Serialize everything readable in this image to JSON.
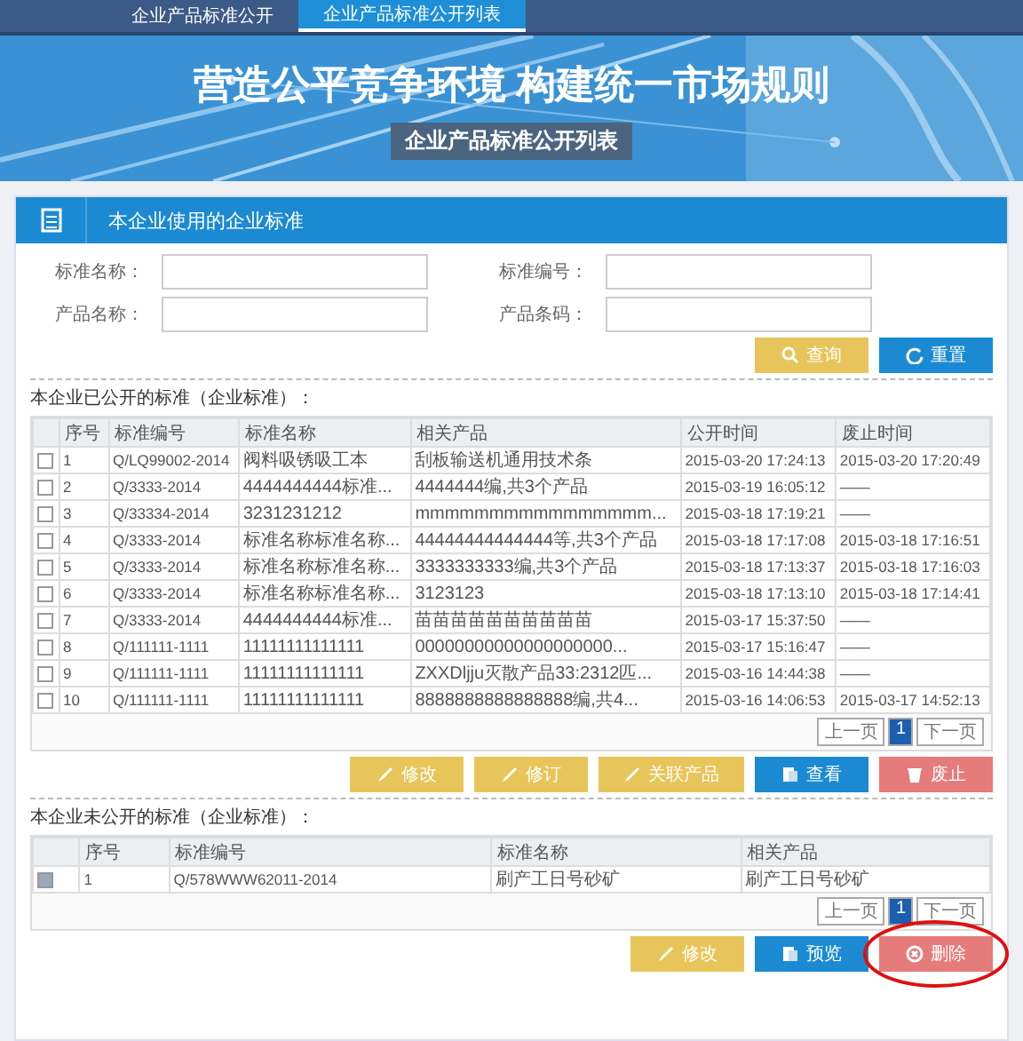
{
  "nav": {
    "tabs": [
      {
        "label": "企业产品标准公开",
        "selected": false
      },
      {
        "label": "企业产品标准公开列表",
        "selected": true
      }
    ]
  },
  "banner": {
    "title": "营造公平竞争环境 构建统一市场规则",
    "subtitle": "企业产品标准公开列表"
  },
  "panel": {
    "title": "本企业使用的企业标准"
  },
  "search": {
    "fields": [
      {
        "label": "标准名称："
      },
      {
        "label": "标准编号："
      },
      {
        "label": "产品名称："
      },
      {
        "label": "产品条码："
      }
    ],
    "buttons": [
      {
        "label": "查询",
        "kind": "search"
      },
      {
        "label": "重置",
        "kind": "reset"
      }
    ]
  },
  "public_table": {
    "caption": "本企业已公开的标准（企业标准）：",
    "columns": [
      "序号",
      "标准编号",
      "标准名称",
      "相关产品",
      "公开时间",
      "废止时间"
    ],
    "rows": [
      {
        "checked": false,
        "cells": [
          "1",
          "Q/LQ99002-2014",
          "阀料吸锈吸工本",
          "刮板输送机通用技术条",
          "2015-03-20 17:24:13",
          "2015-03-20 17:20:49"
        ]
      },
      {
        "checked": false,
        "cells": [
          "2",
          "Q/3333-2014",
          "4444444444标准...",
          "4444444编,共3个产品",
          "2015-03-19 16:05:12",
          "——"
        ]
      },
      {
        "checked": false,
        "cells": [
          "3",
          "Q/33334-2014",
          "3231231212",
          "mmmmmmmmmmmmmmmm...",
          "2015-03-18 17:19:21",
          "——"
        ]
      },
      {
        "checked": false,
        "cells": [
          "4",
          "Q/3333-2014",
          "标准名称标准名称...",
          "44444444444444等,共3个产品",
          "2015-03-18 17:17:08",
          "2015-03-18 17:16:51"
        ]
      },
      {
        "checked": false,
        "cells": [
          "5",
          "Q/3333-2014",
          "标准名称标准名称...",
          "3333333333编,共3个产品",
          "2015-03-18 17:13:37",
          "2015-03-18 17:16:03"
        ]
      },
      {
        "checked": false,
        "cells": [
          "6",
          "Q/3333-2014",
          "标准名称标准名称...",
          "3123123",
          "2015-03-18 17:13:10",
          "2015-03-18 17:14:41"
        ]
      },
      {
        "checked": false,
        "cells": [
          "7",
          "Q/3333-2014",
          "4444444444标准...",
          "苗苗苗苗苗苗苗苗苗苗",
          "2015-03-17 15:37:50",
          "——"
        ]
      },
      {
        "checked": false,
        "cells": [
          "8",
          "Q/111111-1111",
          "11111111111111",
          "00000000000000000000...",
          "2015-03-17 15:16:47",
          "——"
        ]
      },
      {
        "checked": false,
        "cells": [
          "9",
          "Q/111111-1111",
          "11111111111111",
          "ZXXDljju灭散产品33:2312匹...",
          "2015-03-16 14:44:38",
          "——"
        ]
      },
      {
        "checked": false,
        "cells": [
          "10",
          "Q/111111-1111",
          "11111111111111",
          "8888888888888888编,共4...",
          "2015-03-16 14:06:53",
          "2015-03-17 14:52:13"
        ]
      }
    ],
    "pager": [
      {
        "label": "上一页",
        "selected": false
      },
      {
        "label": "1",
        "selected": true
      },
      {
        "label": "下一页",
        "selected": false
      }
    ],
    "buttons": [
      {
        "label": "修改",
        "kind": "edit"
      },
      {
        "label": "修订",
        "kind": "edit"
      },
      {
        "label": "关联产品",
        "kind": "edit"
      },
      {
        "label": "查看",
        "kind": "view"
      },
      {
        "label": "废止",
        "kind": "delete"
      }
    ]
  },
  "private_table": {
    "caption": "本企业未公开的标准（企业标准）：",
    "columns": [
      "序号",
      "标准编号",
      "标准名称",
      "相关产品"
    ],
    "rows": [
      {
        "checked": true,
        "cells": [
          "1",
          "Q/578WWW62011-2014",
          "刷产工日号砂矿",
          "刷产工日号砂矿"
        ]
      }
    ],
    "pager": [
      {
        "label": "上一页",
        "selected": false
      },
      {
        "label": "1",
        "selected": true
      },
      {
        "label": "下一页",
        "selected": false
      }
    ],
    "buttons": [
      {
        "label": "修改",
        "kind": "edit"
      },
      {
        "label": "预览",
        "kind": "view"
      },
      {
        "label": "删除",
        "kind": "remove",
        "circled": true
      }
    ]
  }
}
